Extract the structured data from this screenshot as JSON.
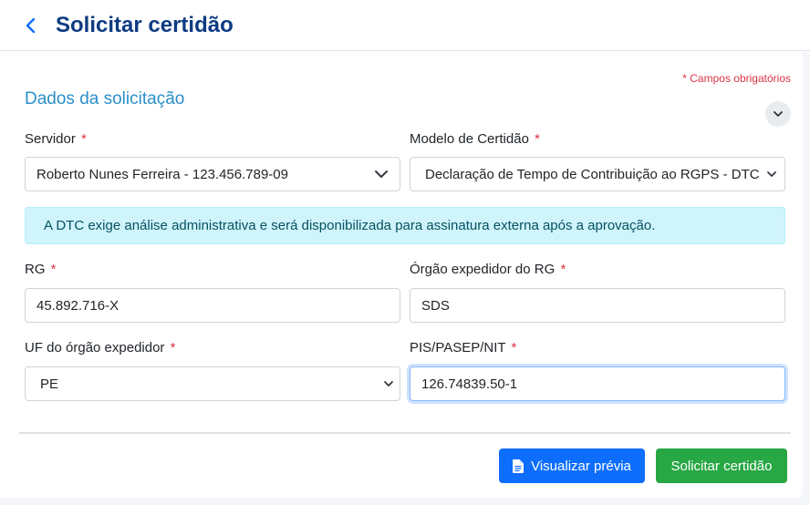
{
  "header": {
    "title": "Solicitar certidão"
  },
  "form": {
    "required_note": "* Campos obrigatórios",
    "section_title": "Dados da solicitação",
    "required_mark": "*",
    "servidor": {
      "label": "Servidor",
      "value": "Roberto Nunes Ferreira - 123.456.789-09"
    },
    "modelo": {
      "label": "Modelo de Certidão",
      "value": "Declaração de Tempo de Contribuição ao RGPS - DTC"
    },
    "alert": "A DTC exige análise administrativa e será disponibilizada para assinatura externa após a aprovação.",
    "rg": {
      "label": "RG",
      "value": "45.892.716-X"
    },
    "orgao": {
      "label": "Órgão expedidor do RG",
      "value": "SDS"
    },
    "uf": {
      "label": "UF do órgão expedidor",
      "value": "PE"
    },
    "pis": {
      "label": "PIS/PASEP/NIT",
      "value": "126.74839.50-1"
    }
  },
  "actions": {
    "preview_label": "Visualizar prévia",
    "submit_label": "Solicitar certidão"
  },
  "icons": {
    "back": "chevron-left-icon",
    "collapse": "chevron-down-icon",
    "select": "chevron-down-icon",
    "preview": "document-icon"
  },
  "colors": {
    "title": "#0d3b82",
    "section": "#2b8fc9",
    "required": "#dc3545",
    "primary": "#0d6efd",
    "success": "#28a745",
    "alert_bg": "#cff4fc",
    "alert_text": "#055160"
  }
}
